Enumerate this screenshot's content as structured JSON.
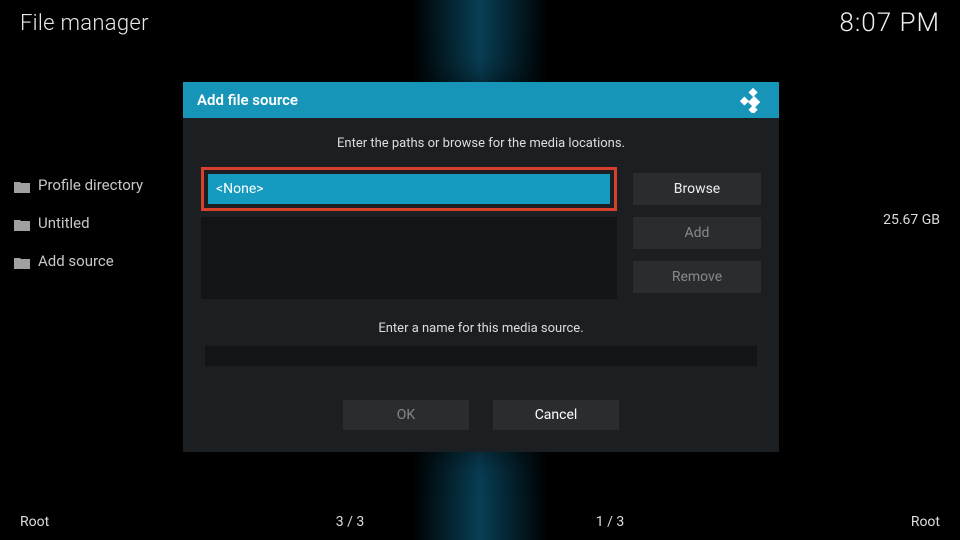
{
  "header": {
    "title": "File manager",
    "clock": "8:07 PM"
  },
  "sidebar": {
    "items": [
      {
        "label": "Profile directory"
      },
      {
        "label": "Untitled"
      },
      {
        "label": "Add source"
      }
    ]
  },
  "disk_size": "25.67 GB",
  "footer": {
    "left": "Root",
    "count_left": "3 / 3",
    "count_right": "1 / 3",
    "right": "Root"
  },
  "dialog": {
    "title": "Add file source",
    "instruction_paths": "Enter the paths or browse for the media locations.",
    "path_value": "<None>",
    "buttons": {
      "browse": "Browse",
      "add": "Add",
      "remove": "Remove"
    },
    "instruction_name": "Enter a name for this media source.",
    "name_value": "",
    "ok": "OK",
    "cancel": "Cancel"
  }
}
